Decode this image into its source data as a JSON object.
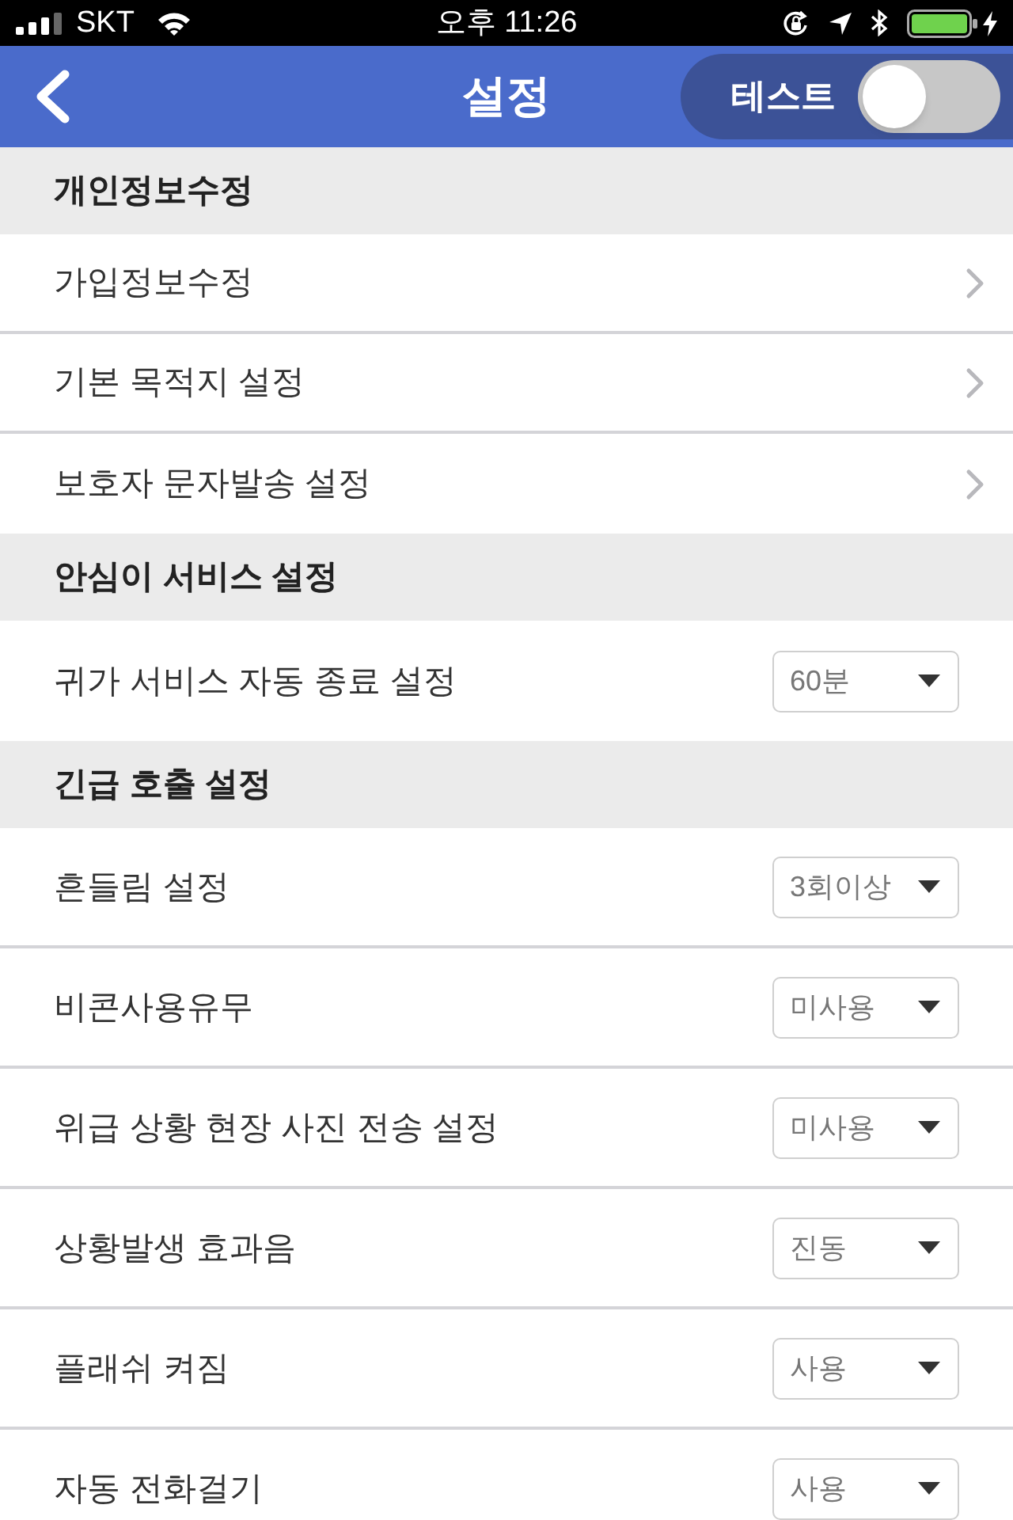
{
  "status_bar": {
    "carrier": "SKT",
    "time": "오후 11:26"
  },
  "nav_bar": {
    "title": "설정",
    "toggle": {
      "label": "테스트",
      "on": false
    }
  },
  "sections": [
    {
      "title": "개인정보수정",
      "items": [
        {
          "kind": "link",
          "label": "가입정보수정"
        },
        {
          "kind": "link",
          "label": "기본 목적지 설정"
        },
        {
          "kind": "link",
          "label": "보호자 문자발송 설정"
        }
      ]
    },
    {
      "title": "안심이 서비스 설정",
      "items": [
        {
          "kind": "select",
          "label": "귀가 서비스 자동 종료 설정",
          "value": "60분"
        }
      ]
    },
    {
      "title": "긴급 호출 설정",
      "items": [
        {
          "kind": "select",
          "label": "흔들림 설정",
          "value": "3회이상"
        },
        {
          "kind": "select",
          "label": "비콘사용유무",
          "value": "미사용"
        },
        {
          "kind": "select",
          "label": "위급 상황 현장 사진 전송 설정",
          "value": "미사용"
        },
        {
          "kind": "select",
          "label": "상황발생 효과음",
          "value": "진동"
        },
        {
          "kind": "select",
          "label": "플래쉬 켜짐",
          "value": "사용"
        },
        {
          "kind": "select",
          "label": "자동 전화걸기",
          "value": "사용"
        }
      ]
    }
  ]
}
